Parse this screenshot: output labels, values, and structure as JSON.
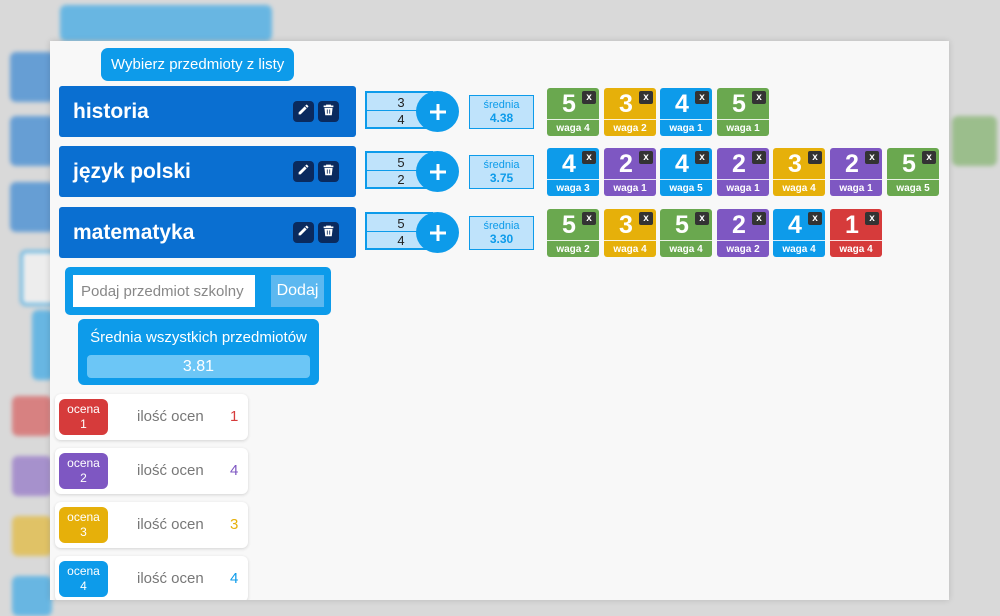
{
  "header": {
    "pick_subjects_label": "Wybierz przedmioty z listy"
  },
  "subjects": [
    {
      "name": "historia",
      "numerator": "3",
      "denominator": "4",
      "avg_label": "średnia",
      "avg_value": "4.38",
      "grades": [
        {
          "value": "5",
          "weight": "waga 4",
          "color": "#6aa84f"
        },
        {
          "value": "3",
          "weight": "waga 2",
          "color": "#e6b00a"
        },
        {
          "value": "4",
          "weight": "waga 1",
          "color": "#0d9bea"
        },
        {
          "value": "5",
          "weight": "waga 1",
          "color": "#6aa84f"
        }
      ]
    },
    {
      "name": "język polski",
      "numerator": "5",
      "denominator": "2",
      "avg_label": "średnia",
      "avg_value": "3.75",
      "grades": [
        {
          "value": "4",
          "weight": "waga 3",
          "color": "#0d9bea"
        },
        {
          "value": "2",
          "weight": "waga 1",
          "color": "#7e57c2"
        },
        {
          "value": "4",
          "weight": "waga 5",
          "color": "#0d9bea"
        },
        {
          "value": "2",
          "weight": "waga 1",
          "color": "#7e57c2"
        },
        {
          "value": "3",
          "weight": "waga 4",
          "color": "#e6b00a"
        },
        {
          "value": "2",
          "weight": "waga 1",
          "color": "#7e57c2"
        },
        {
          "value": "5",
          "weight": "waga 5",
          "color": "#6aa84f"
        }
      ]
    },
    {
      "name": "matematyka",
      "numerator": "5",
      "denominator": "4",
      "avg_label": "średnia",
      "avg_value": "3.30",
      "grades": [
        {
          "value": "5",
          "weight": "waga 2",
          "color": "#6aa84f"
        },
        {
          "value": "3",
          "weight": "waga 4",
          "color": "#e6b00a"
        },
        {
          "value": "5",
          "weight": "waga 4",
          "color": "#6aa84f"
        },
        {
          "value": "2",
          "weight": "waga 2",
          "color": "#7e57c2"
        },
        {
          "value": "4",
          "weight": "waga 4",
          "color": "#0d9bea"
        },
        {
          "value": "1",
          "weight": "waga 4",
          "color": "#d63b3b"
        }
      ]
    }
  ],
  "grade_delete_label": "x",
  "add_subject": {
    "placeholder": "Podaj przedmiot szkolny",
    "button_label": "Dodaj"
  },
  "overall": {
    "title": "Średnia wszystkich przedmiotów",
    "value": "3.81"
  },
  "grade_counts": [
    {
      "badge_top": "ocena",
      "badge_grade": "1",
      "label": "ilość ocen",
      "count": "1",
      "color": "#d63b3b"
    },
    {
      "badge_top": "ocena",
      "badge_grade": "2",
      "label": "ilość ocen",
      "count": "4",
      "color": "#7e57c2"
    },
    {
      "badge_top": "ocena",
      "badge_grade": "3",
      "label": "ilość ocen",
      "count": "3",
      "color": "#e6b00a"
    },
    {
      "badge_top": "ocena",
      "badge_grade": "4",
      "label": "ilość ocen",
      "count": "4",
      "color": "#0d9bea"
    }
  ],
  "icons": {
    "edit": "pencil-icon",
    "delete": "trash-icon",
    "add": "plus-icon"
  }
}
